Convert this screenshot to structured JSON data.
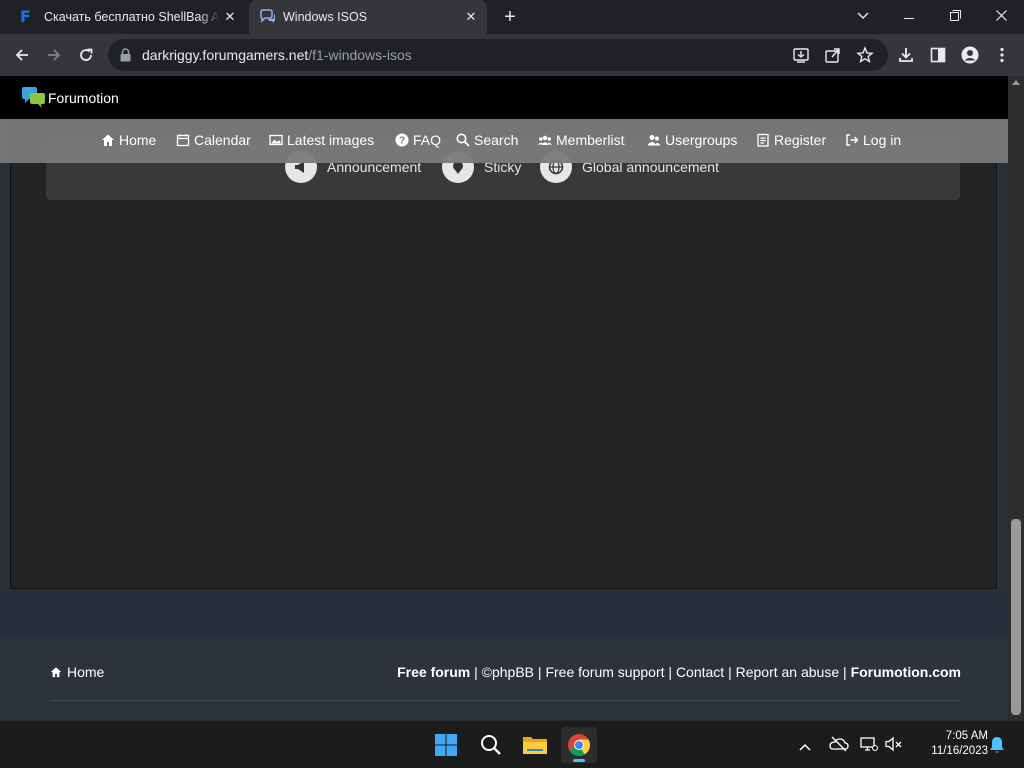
{
  "browser": {
    "tabs": [
      {
        "title": "Скачать бесплатно ShellBag Ana",
        "favicon": "F"
      },
      {
        "title": "Windows ISOS"
      }
    ],
    "url_host": "darkriggy.forumgamers.net",
    "url_path": "/f1-windows-isos"
  },
  "site": {
    "brand": "Forumotion",
    "nav": [
      {
        "label": "Home",
        "icon": "home-icon"
      },
      {
        "label": "Calendar",
        "icon": "calendar-icon"
      },
      {
        "label": "Latest images",
        "icon": "image-icon"
      },
      {
        "label": "FAQ",
        "icon": "help-icon"
      },
      {
        "label": "Search",
        "icon": "search-icon"
      },
      {
        "label": "Memberlist",
        "icon": "members-icon"
      },
      {
        "label": "Usergroups",
        "icon": "groups-icon"
      },
      {
        "label": "Register",
        "icon": "register-icon"
      },
      {
        "label": "Log in",
        "icon": "login-icon"
      }
    ],
    "legend": [
      "Announcement",
      "Sticky",
      "Global announcement"
    ]
  },
  "footer": {
    "home": "Home",
    "free_forum": "Free forum",
    "phpbb": "©phpBB",
    "support": "Free forum support",
    "contact": "Contact",
    "report": "Report an abuse",
    "forumotion": "Forumotion.com",
    "sep": "|"
  },
  "taskbar": {
    "time": "7:05 AM",
    "date": "11/16/2023",
    "apps": [
      "start",
      "search",
      "file-explorer",
      "chrome"
    ]
  },
  "colors": {
    "tab_active": "#35363a",
    "page_bg": "#232323",
    "navbar_bg": "#7a7a7a",
    "footer_bg": "#2d333a"
  }
}
